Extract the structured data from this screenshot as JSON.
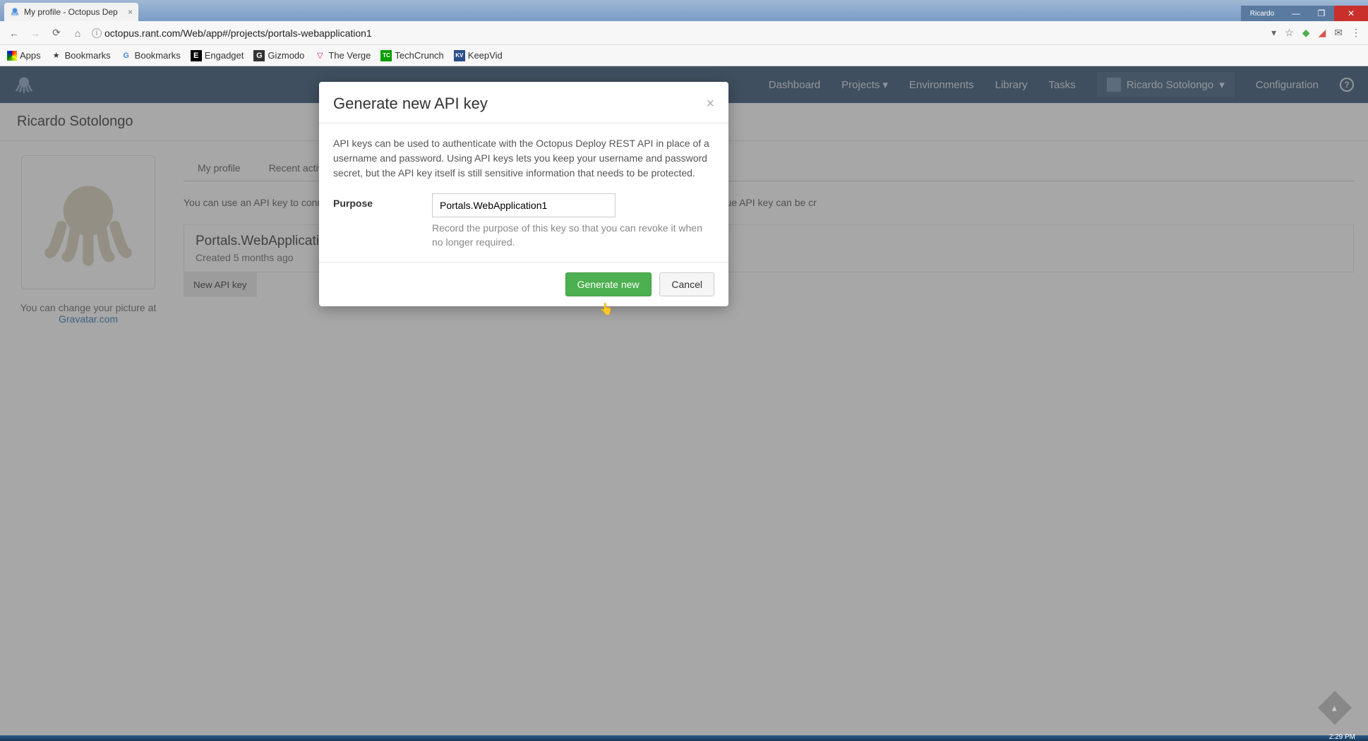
{
  "browser": {
    "tab_title": "My profile - Octopus Dep",
    "url": "octopus.rant.com/Web/app#/projects/portals-webapplication1",
    "user_badge": "Ricardo",
    "bookmarks": [
      {
        "label": "Apps"
      },
      {
        "label": "Bookmarks"
      },
      {
        "label": "Bookmarks"
      },
      {
        "label": "Engadget"
      },
      {
        "label": "Gizmodo"
      },
      {
        "label": "The Verge"
      },
      {
        "label": "TechCrunch"
      },
      {
        "label": "KeepVid"
      }
    ]
  },
  "nav": {
    "links": [
      "Dashboard",
      "Projects",
      "Environments",
      "Library",
      "Tasks"
    ],
    "user": "Ricardo Sotolongo",
    "config": "Configuration"
  },
  "page": {
    "title": "Ricardo Sotolongo",
    "gravatar_text": "You can change your picture at",
    "gravatar_link": "Gravatar.com",
    "tabs": [
      "My profile",
      "Recent activity"
    ],
    "intro": "You can use an API key to connect                                                                                                                                                                                                   avoid the need to record your personal password in configuration files and scripts. A unique API key can be cr",
    "key_name": "Portals.WebApplication",
    "key_created": "Created 5 months ago",
    "new_key_btn": "New API key"
  },
  "modal": {
    "title": "Generate new API key",
    "desc": "API keys can be used to authenticate with the Octopus Deploy REST API in place of a username and password. Using API keys lets you keep your username and password secret, but the API key itself is still sensitive information that needs to be protected.",
    "purpose_label": "Purpose",
    "purpose_value": "Portals.WebApplication1",
    "hint": "Record the purpose of this key so that you can revoke it when no longer required.",
    "generate_btn": "Generate new",
    "cancel_btn": "Cancel"
  },
  "taskbar": {
    "time": "2:29 PM"
  }
}
